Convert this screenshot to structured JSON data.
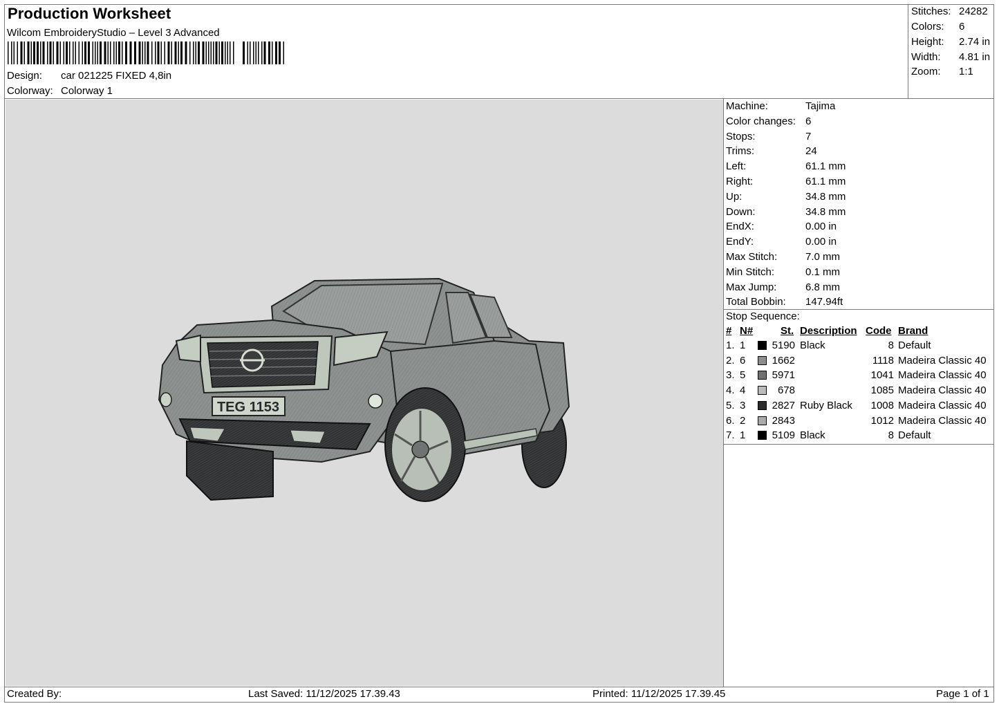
{
  "header": {
    "title": "Production Worksheet",
    "software": "Wilcom EmbroideryStudio – Level 3 Advanced",
    "design_label": "Design:",
    "design_value": "car 021225 FIXED 4,8in",
    "colorway_label": "Colorway:",
    "colorway_value": "Colorway 1"
  },
  "stats": [
    {
      "label": "Stitches:",
      "value": "24282"
    },
    {
      "label": "Colors:",
      "value": "6"
    },
    {
      "label": "Height:",
      "value": "2.74 in"
    },
    {
      "label": "Width:",
      "value": "4.81 in"
    },
    {
      "label": "Zoom:",
      "value": "1:1"
    }
  ],
  "machine_info": [
    {
      "label": "Machine:",
      "value": "Tajima"
    },
    {
      "label": "Color changes:",
      "value": "6"
    },
    {
      "label": "Stops:",
      "value": "7"
    },
    {
      "label": "Trims:",
      "value": "24"
    },
    {
      "label": "Left:",
      "value": "61.1 mm"
    },
    {
      "label": "Right:",
      "value": "61.1 mm"
    },
    {
      "label": "Up:",
      "value": "34.8 mm"
    },
    {
      "label": "Down:",
      "value": "34.8 mm"
    },
    {
      "label": "EndX:",
      "value": "0.00 in"
    },
    {
      "label": "EndY:",
      "value": "0.00 in"
    },
    {
      "label": "Max Stitch:",
      "value": "7.0 mm"
    },
    {
      "label": "Min Stitch:",
      "value": "0.1 mm"
    },
    {
      "label": "Max Jump:",
      "value": "6.8 mm"
    },
    {
      "label": "Total Bobbin:",
      "value": "147.94ft"
    }
  ],
  "stop_sequence": {
    "title": "Stop Sequence:",
    "headers": {
      "num": "#",
      "n": "N#",
      "st": "St.",
      "description": "Description",
      "code": "Code",
      "brand": "Brand"
    },
    "rows": [
      {
        "num": "1.",
        "n": "1",
        "color": "#000000",
        "st": "5190",
        "description": "Black",
        "code": "8",
        "brand": "Default"
      },
      {
        "num": "2.",
        "n": "6",
        "color": "#8a8e8c",
        "st": "1662",
        "description": "",
        "code": "1118",
        "brand": "Madeira Classic 40"
      },
      {
        "num": "3.",
        "n": "5",
        "color": "#6c706e",
        "st": "5971",
        "description": "",
        "code": "1041",
        "brand": "Madeira Classic 40"
      },
      {
        "num": "4.",
        "n": "4",
        "color": "#b9bcb8",
        "st": "678",
        "description": "",
        "code": "1085",
        "brand": "Madeira Classic 40"
      },
      {
        "num": "5.",
        "n": "3",
        "color": "#2a2a2c",
        "st": "2827",
        "description": "Ruby Black",
        "code": "1008",
        "brand": "Madeira Classic 40"
      },
      {
        "num": "6.",
        "n": "2",
        "color": "#a6aaa8",
        "st": "2843",
        "description": "",
        "code": "1012",
        "brand": "Madeira Classic 40"
      },
      {
        "num": "7.",
        "n": "1",
        "color": "#000000",
        "st": "5109",
        "description": "Black",
        "code": "8",
        "brand": "Default"
      }
    ]
  },
  "design_preview": {
    "plate_text": "TEG 1153",
    "background_color": "#dcdcdc",
    "body_color": "#8d918f",
    "dark_color": "#2a2a2c",
    "light_color": "#c9d3c8"
  },
  "footer": {
    "created_by": "Created By:",
    "last_saved": "Last Saved: 11/12/2025 17.39.43",
    "printed": "Printed: 11/12/2025 17.39.45",
    "page": "Page 1 of 1"
  }
}
